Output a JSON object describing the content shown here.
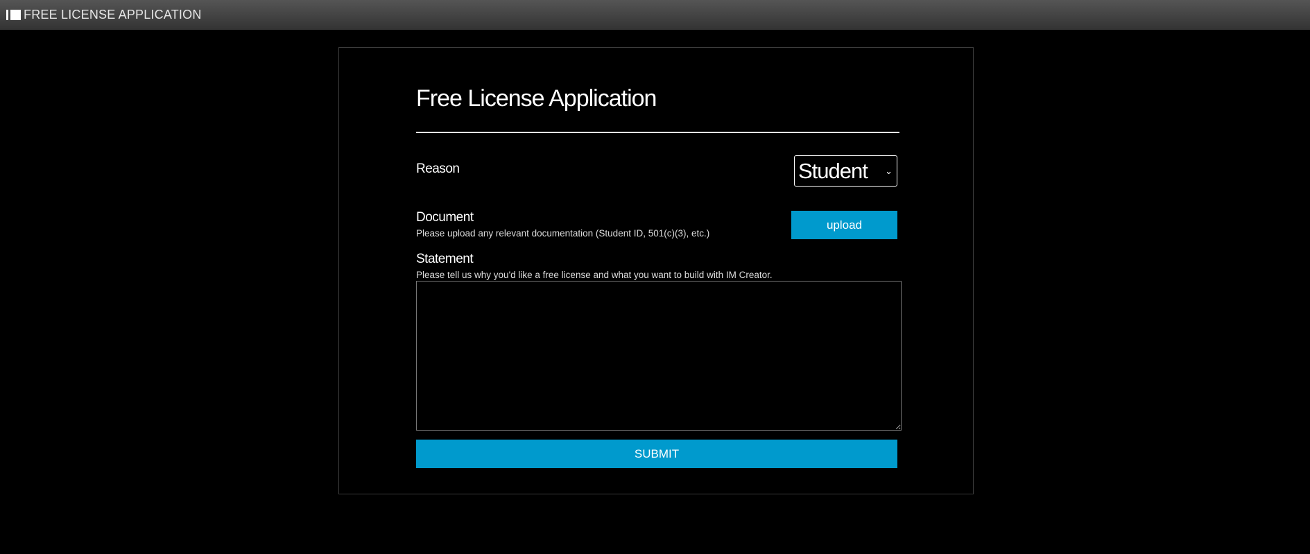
{
  "header": {
    "title": "FREE LICENSE APPLICATION",
    "logo_icon": "im-creator-logo-icon"
  },
  "form": {
    "title": "Free License Application",
    "reason": {
      "label": "Reason",
      "selected": "Student"
    },
    "document": {
      "label": "Document",
      "help": "Please upload any relevant documentation (Student ID, 501(c)(3), etc.)",
      "upload_label": "upload"
    },
    "statement": {
      "label": "Statement",
      "help": "Please tell us why you'd like a free license and what you want to build with IM Creator.",
      "value": ""
    },
    "submit_label": "SUBMIT"
  },
  "colors": {
    "accent": "#009acd",
    "background": "#000000",
    "text": "#ffffff"
  }
}
